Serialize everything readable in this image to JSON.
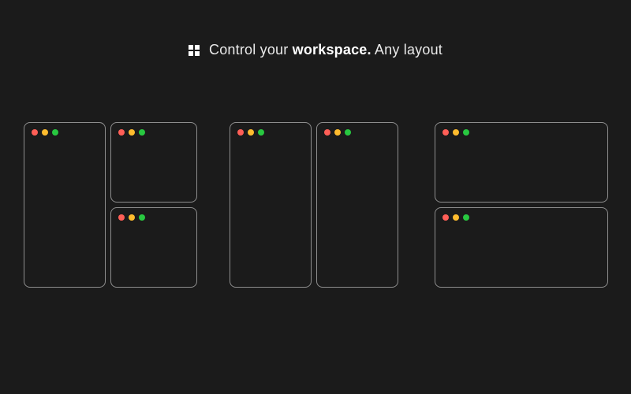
{
  "headline": {
    "prefix": "Control your ",
    "bold": "workspace.",
    "suffix": " Any layout"
  },
  "icon_name": "grid-icon",
  "traffic_light_colors": {
    "close": "#ff5f57",
    "minimize": "#febc2e",
    "zoom": "#28c840"
  }
}
